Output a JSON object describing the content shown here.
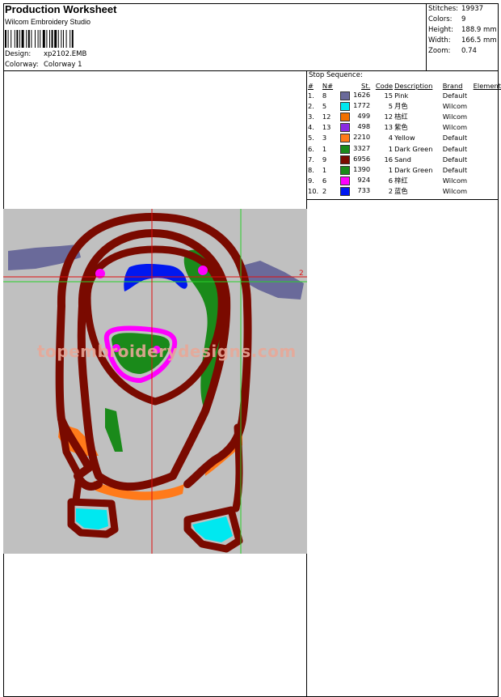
{
  "header": {
    "title": "Production Worksheet",
    "software": "Wilcom  Embroidery Studio",
    "design_label": "Design:",
    "design_value": "xp2102.EMB",
    "colorway_label": "Colorway:",
    "colorway_value": "Colorway 1"
  },
  "stats": [
    {
      "label": "Stitches:",
      "value": "19937"
    },
    {
      "label": "Colors:",
      "value": "9"
    },
    {
      "label": "Height:",
      "value": "188.9 mm"
    },
    {
      "label": "Width:",
      "value": "166.5 mm"
    },
    {
      "label": "Zoom:",
      "value": "0.74"
    }
  ],
  "stop_sequence": {
    "title": "Stop Sequence:",
    "columns": [
      "#",
      "N#",
      "St.",
      "Code",
      "Description",
      "Brand",
      "Element"
    ],
    "rows": [
      {
        "num": "1.",
        "n": "8",
        "color": "#6a6a9a",
        "st": "1626",
        "code": "15",
        "desc": "Pink",
        "brand": "Default"
      },
      {
        "num": "2.",
        "n": "5",
        "color": "#00e8f0",
        "st": "1772",
        "code": "5",
        "desc": "月色",
        "brand": "Wilcom"
      },
      {
        "num": "3.",
        "n": "12",
        "color": "#f07000",
        "st": "499",
        "code": "12",
        "desc": "桔红",
        "brand": "Wilcom"
      },
      {
        "num": "4.",
        "n": "13",
        "color": "#8a2be2",
        "st": "498",
        "code": "13",
        "desc": "紫色",
        "brand": "Wilcom"
      },
      {
        "num": "5.",
        "n": "3",
        "color": "#ff7a1a",
        "st": "2210",
        "code": "4",
        "desc": "Yellow",
        "brand": "Default"
      },
      {
        "num": "6.",
        "n": "1",
        "color": "#1a8a1a",
        "st": "3327",
        "code": "1",
        "desc": "Dark Green",
        "brand": "Default"
      },
      {
        "num": "7.",
        "n": "9",
        "color": "#7a0a00",
        "st": "6956",
        "code": "16",
        "desc": "Sand",
        "brand": "Default"
      },
      {
        "num": "8.",
        "n": "1",
        "color": "#1a8a1a",
        "st": "1390",
        "code": "1",
        "desc": "Dark Green",
        "brand": "Default"
      },
      {
        "num": "9.",
        "n": "6",
        "color": "#ff00ff",
        "st": "924",
        "code": "6",
        "desc": "梓红",
        "brand": "Wilcom"
      },
      {
        "num": "10.",
        "n": "2",
        "color": "#0018f0",
        "st": "733",
        "code": "2",
        "desc": "蓝色",
        "brand": "Wilcom"
      }
    ]
  },
  "canvas": {
    "watermark": "topembroiderydesigns.com",
    "axis_marker": "2"
  }
}
